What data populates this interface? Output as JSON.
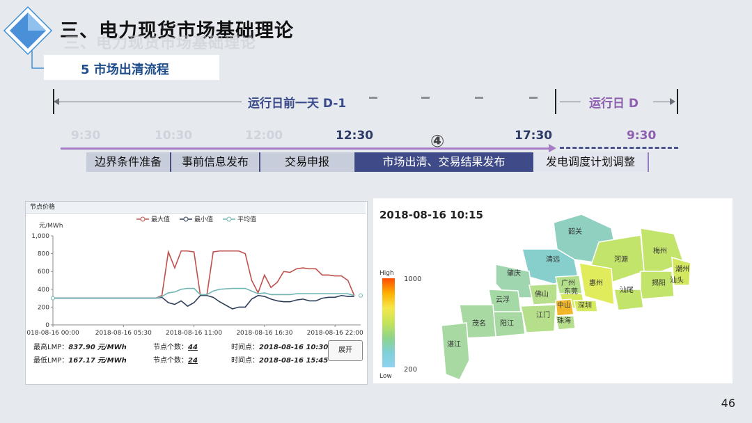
{
  "header": {
    "title": "三、电力现货市场基础理论",
    "subtitle": "5 市场出清流程"
  },
  "timeline": {
    "d_minus_1_label": "运行日前一天 D-1",
    "d_label": "运行日 D",
    "times": [
      "9:30",
      "10:30",
      "12:00",
      "12:30",
      "17:30",
      "9:30"
    ],
    "step_marker": "④",
    "steps": [
      "边界条件准备",
      "事前信息发布",
      "交易申报",
      "市场出清、交易结果发布",
      "发电调度计划调整"
    ]
  },
  "lmp_panel": {
    "title": "节点价格",
    "unit": "元/MWh",
    "legend": [
      "最大值",
      "最小值",
      "平均值"
    ],
    "colors": {
      "max": "#c0504d",
      "min": "#2f3f5a",
      "avg": "#6fb6b4"
    },
    "y_ticks": [
      "1,000",
      "800",
      "600",
      "400",
      "200",
      "0"
    ],
    "x_ticks": [
      "018-08-16 00:00",
      "2018-08-16 05:30",
      "2018-08-16 11:00",
      "2018-08-16 16:30",
      "2018-08-16 22:00"
    ],
    "stats": {
      "max_label": "最高LMP：",
      "max_value": "837.90",
      "unit": "元/MWh",
      "min_label": "最低LMP：",
      "min_value": "167.17",
      "count_label": "节点个数：",
      "max_count": "44",
      "min_count": "24",
      "time_label": "时间点：",
      "max_time": "2018-08-16 10:30",
      "min_time": "2018-08-16 15:45"
    },
    "expand_button": "展开"
  },
  "chart_data": {
    "type": "line",
    "title": "节点价格",
    "ylabel": "元/MWh",
    "ylim": [
      0,
      1000
    ],
    "x_hours": [
      0,
      1,
      2,
      3,
      4,
      5,
      6,
      7,
      8,
      8.5,
      9,
      9.5,
      10,
      10.5,
      11,
      11.5,
      12,
      12.5,
      13,
      14,
      14.5,
      15,
      15.5,
      16,
      16.5,
      17,
      17.5,
      18,
      18.5,
      19,
      19.5,
      20,
      20.5,
      21,
      21.5,
      22,
      22.5,
      23,
      23.5
    ],
    "series": [
      {
        "name": "最大值",
        "values": [
          300,
          300,
          300,
          300,
          300,
          300,
          300,
          300,
          300,
          330,
          820,
          640,
          830,
          830,
          820,
          330,
          330,
          820,
          830,
          830,
          830,
          800,
          500,
          360,
          560,
          420,
          480,
          600,
          590,
          630,
          640,
          630,
          630,
          560,
          560,
          550,
          550,
          500,
          330
        ]
      },
      {
        "name": "最小值",
        "values": [
          300,
          300,
          300,
          300,
          300,
          300,
          300,
          300,
          300,
          310,
          250,
          230,
          270,
          210,
          250,
          330,
          330,
          310,
          260,
          180,
          200,
          200,
          290,
          330,
          320,
          290,
          270,
          260,
          260,
          280,
          290,
          270,
          270,
          300,
          310,
          310,
          330,
          320,
          320
        ]
      },
      {
        "name": "平均值",
        "values": [
          300,
          300,
          300,
          300,
          300,
          300,
          300,
          300,
          300,
          320,
          360,
          370,
          400,
          410,
          410,
          340,
          340,
          380,
          400,
          410,
          410,
          410,
          380,
          350,
          360,
          340,
          340,
          340,
          340,
          350,
          350,
          350,
          350,
          350,
          350,
          350,
          350,
          350,
          330
        ]
      }
    ]
  },
  "map_panel": {
    "timestamp": "2018-08-16 10:15",
    "legend_high": "High",
    "legend_low": "Low",
    "legend_max": "1000",
    "legend_min": "200",
    "cities": [
      "韶关",
      "清远",
      "河源",
      "梅州",
      "潮州",
      "揭阳",
      "汕头",
      "肇庆",
      "广州",
      "惠州",
      "汕尾",
      "云浮",
      "佛山",
      "东莞",
      "深圳",
      "中山",
      "江门",
      "珠海",
      "阳江",
      "茂名",
      "湛江"
    ]
  },
  "footer": {
    "page_number": "46"
  }
}
